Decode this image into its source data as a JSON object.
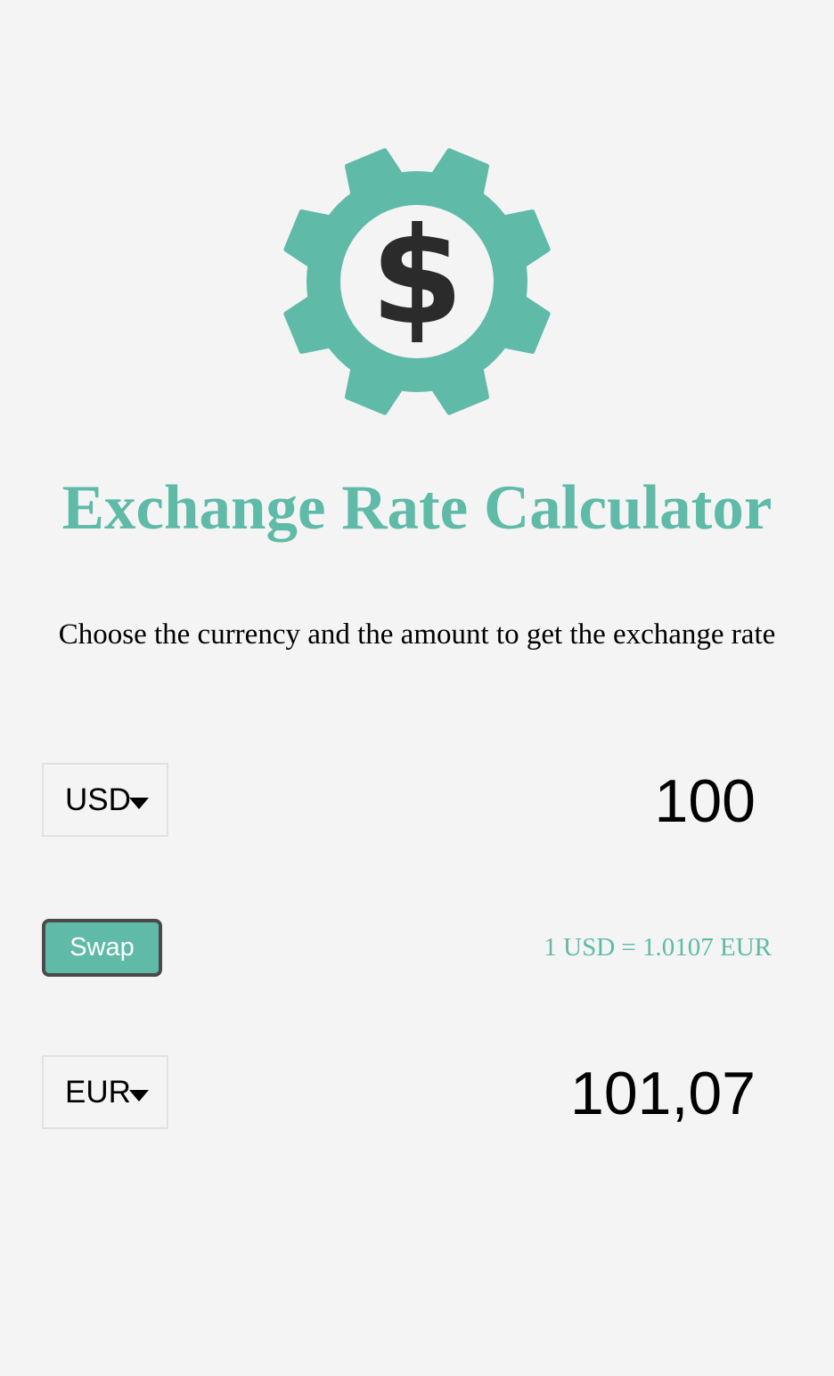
{
  "logo": {
    "icon": "gear-dollar-icon",
    "gear_color": "#5fbaa7",
    "dollar_symbol": "$"
  },
  "header": {
    "title": "Exchange Rate Calculator",
    "subtitle": "Choose the currency and the amount to get the exchange rate"
  },
  "currency_one": {
    "code": "USD",
    "amount": "100"
  },
  "swap": {
    "label": "Swap",
    "rate_text": "1 USD = 1.0107 EUR"
  },
  "currency_two": {
    "code": "EUR",
    "amount": "101,07"
  },
  "colors": {
    "accent": "#5fbaa7",
    "background": "#f4f4f4",
    "button_border": "#4a4a4a"
  }
}
